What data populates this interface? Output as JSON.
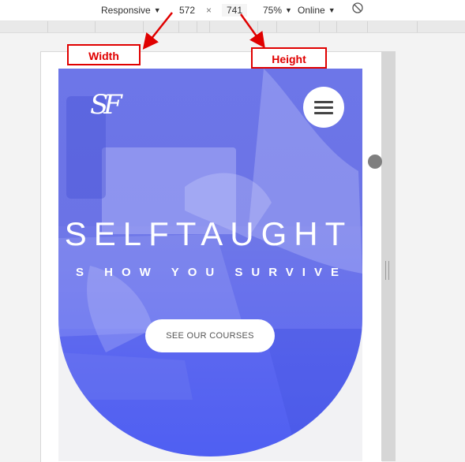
{
  "toolbar": {
    "device_mode": "Responsive",
    "width": "572",
    "separator": "×",
    "height": "741",
    "zoom": "75%",
    "throttling": "Online",
    "rotate_icon": "rotate-icon"
  },
  "annotations": {
    "width_label": "Width",
    "height_label": "Height",
    "color": "#e00000"
  },
  "page": {
    "logo": "SF",
    "title": "SELFTAUGHT",
    "subtitle": "S HOW YOU SURVIVE",
    "cta_label": "SEE OUR COURSES",
    "hero_color": "#5a66f0"
  }
}
